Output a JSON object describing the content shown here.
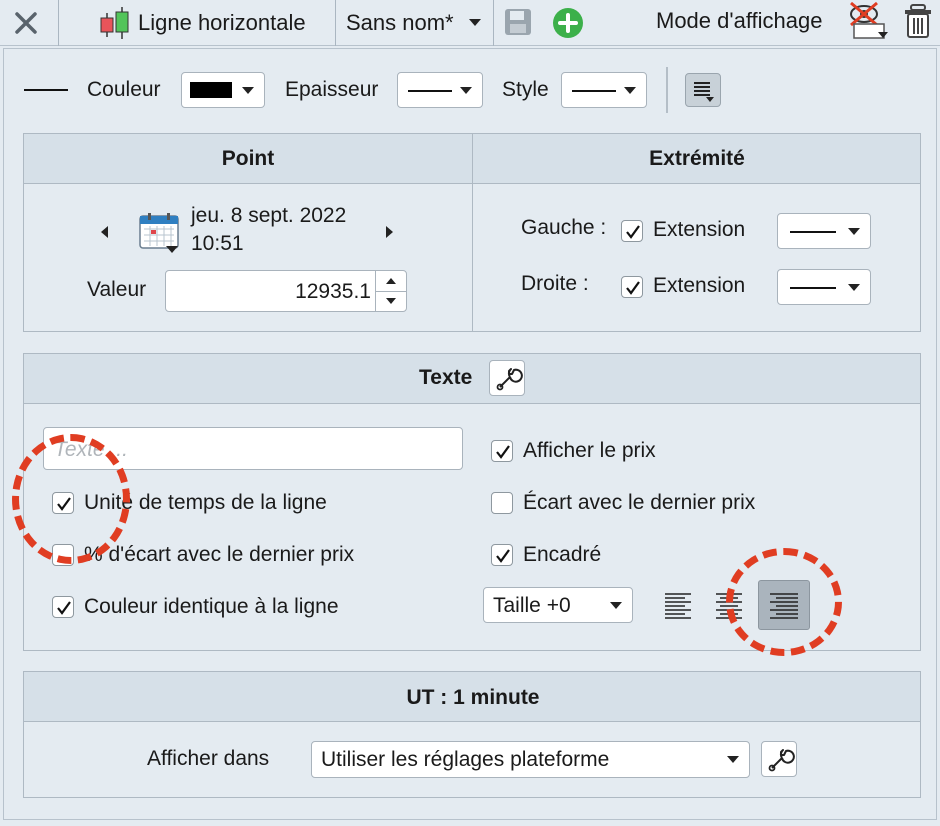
{
  "topbar": {
    "title": "Ligne horizontale",
    "template": "Sans nom*",
    "display_mode": "Mode d'affichage"
  },
  "toolbar": {
    "color_label": "Couleur",
    "thickness_label": "Epaisseur",
    "style_label": "Style"
  },
  "point": {
    "header": "Point",
    "date": "jeu. 8 sept. 2022",
    "time": "10:51",
    "value_label": "Valeur",
    "value": "12935.1"
  },
  "extremity": {
    "header": "Extrémité",
    "left_label": "Gauche :",
    "right_label": "Droite :",
    "extension_label": "Extension"
  },
  "text_section": {
    "header": "Texte",
    "placeholder": "Texte ...",
    "opt_timeframe": "Unité de temps de la ligne",
    "opt_pct": "% d'écart avec le dernier prix",
    "opt_same_color": "Couleur identique à la ligne",
    "opt_show_price": "Afficher le prix",
    "opt_gap": "Écart avec le dernier prix",
    "opt_framed": "Encadré",
    "size": "Taille +0"
  },
  "ut_section": {
    "header": "UT : 1 minute",
    "show_in_label": "Afficher dans",
    "show_in_value": "Utiliser les réglages plateforme"
  },
  "colors": {
    "accent_green": "#3cb04a",
    "annotation_red": "#e03d22"
  }
}
